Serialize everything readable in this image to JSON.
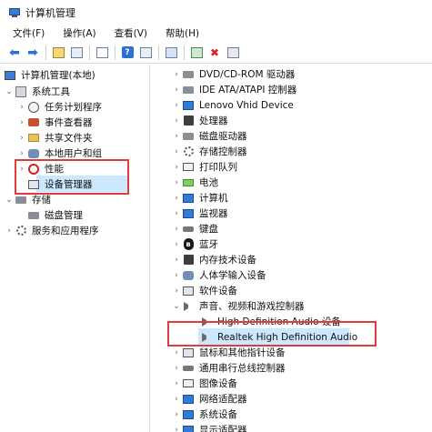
{
  "window": {
    "title": "计算机管理"
  },
  "menu": [
    "文件(F)",
    "操作(A)",
    "查看(V)",
    "帮助(H)"
  ],
  "toolbar": [
    {
      "icon": "back-arrow-icon"
    },
    {
      "icon": "forward-arrow-icon"
    },
    {
      "icon": "up-folder-icon"
    },
    {
      "icon": "console-tree-icon"
    },
    {
      "icon": "properties-icon"
    },
    {
      "icon": "help-icon"
    },
    {
      "icon": "show-panel-icon"
    },
    {
      "icon": "scan-hardware-icon"
    },
    {
      "icon": "update-driver-icon"
    },
    {
      "icon": "uninstall-icon"
    },
    {
      "icon": "enable-device-icon"
    }
  ],
  "left_tree": {
    "root": "计算机管理(本地)",
    "system_tools": "系统工具",
    "items": [
      "任务计划程序",
      "事件查看器",
      "共享文件夹",
      "本地用户和组",
      "性能",
      "设备管理器"
    ],
    "storage": "存储",
    "disk_mgmt": "磁盘管理",
    "services": "服务和应用程序"
  },
  "devices": [
    "DVD/CD-ROM 驱动器",
    "IDE ATA/ATAPI 控制器",
    "Lenovo Vhid Device",
    "处理器",
    "磁盘驱动器",
    "存储控制器",
    "打印队列",
    "电池",
    "计算机",
    "监视器",
    "键盘",
    "蓝牙",
    "内存技术设备",
    "人体学输入设备",
    "软件设备",
    "声音、视频和游戏控制器",
    "High Definition Audio 设备",
    "Realtek High Definition Audio",
    "鼠标和其他指针设备",
    "通用串行总线控制器",
    "图像设备",
    "网络适配器",
    "系统设备",
    "显示适配器"
  ],
  "colors": {
    "selection": "#cce8ff",
    "highlight_border": "#e23b3b"
  }
}
